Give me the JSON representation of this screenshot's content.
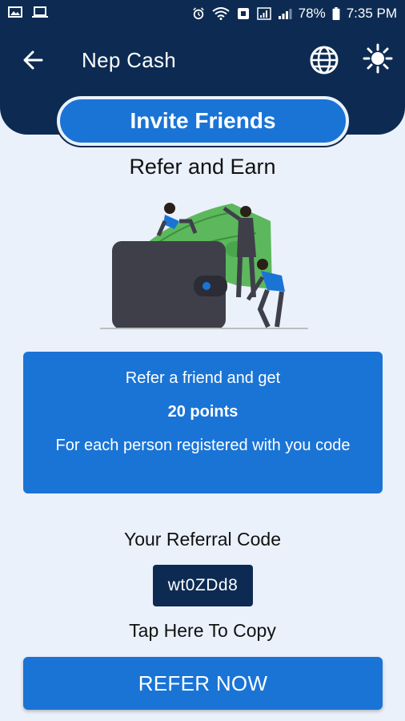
{
  "status_bar": {
    "battery": "78%",
    "time": "7:35 PM",
    "icons": [
      "image-icon",
      "laptop-icon",
      "alarm-icon",
      "wifi-icon",
      "data-saver-icon",
      "signal-icon",
      "battery-icon"
    ]
  },
  "appbar": {
    "title": "Nep Cash",
    "icons": [
      "back-arrow-icon",
      "globe-icon",
      "theme-toggle-icon"
    ]
  },
  "invite": {
    "label": "Invite Friends"
  },
  "section": {
    "title": "Refer and Earn"
  },
  "info_card": {
    "line1": "Refer a friend and get",
    "points": "20 points",
    "line3": "For each person registered with you code"
  },
  "referral": {
    "label": "Your Referral Code",
    "code": "wt0ZDd8",
    "copy_text": "Tap Here To Copy"
  },
  "cta": {
    "label": "REFER NOW"
  },
  "colors": {
    "header": "#0d2b52",
    "primary": "#1a74d6",
    "background": "#eaf1fb",
    "money_green": "#5cb85c",
    "wallet": "#3f3f4a"
  }
}
